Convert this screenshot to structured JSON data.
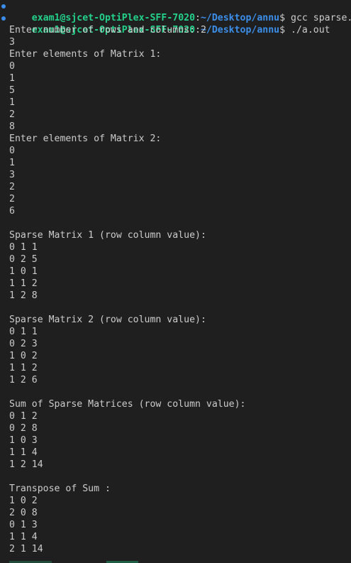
{
  "prompts": [
    {
      "user_host": "exam1@sjcet-OptiPlex-SFF-7020",
      "sep": ":",
      "path": "~/Desktop/annu",
      "symbol": "$ ",
      "command": "gcc sparse.c"
    },
    {
      "user_host": "exam1@sjcet-OptiPlex-SFF-7020",
      "sep": ":",
      "path": "~/Desktop/annu",
      "symbol": "$ ",
      "command": "./a.out"
    }
  ],
  "output_lines": [
    "Enter number of rows and columns: 2",
    "3",
    "Enter elements of Matrix 1:",
    "0",
    "1",
    "5",
    "1",
    "2",
    "8",
    "Enter elements of Matrix 2:",
    "0",
    "1",
    "3",
    "2",
    "2",
    "6",
    "",
    "Sparse Matrix 1 (row column value):",
    "0 1 1",
    "0 2 5",
    "1 0 1",
    "1 1 2",
    "1 2 8",
    "",
    "Sparse Matrix 2 (row column value):",
    "0 1 1",
    "0 2 3",
    "1 0 2",
    "1 1 2",
    "1 2 6",
    "",
    "Sum of Sparse Matrices (row column value):",
    "0 1 2",
    "0 2 8",
    "1 0 3",
    "1 1 4",
    "1 2 14",
    "",
    "Transpose of Sum :",
    "1 0 2",
    "2 0 8",
    "0 1 3",
    "1 1 4",
    "2 1 14"
  ],
  "colors": {
    "background": "#1f1f1f",
    "text": "#cccccc",
    "user_host": "#23d18b",
    "path": "#3b8eea",
    "decoration_dot": "#3b8eea"
  },
  "icons": [
    "command-decoration-dot-icon"
  ]
}
